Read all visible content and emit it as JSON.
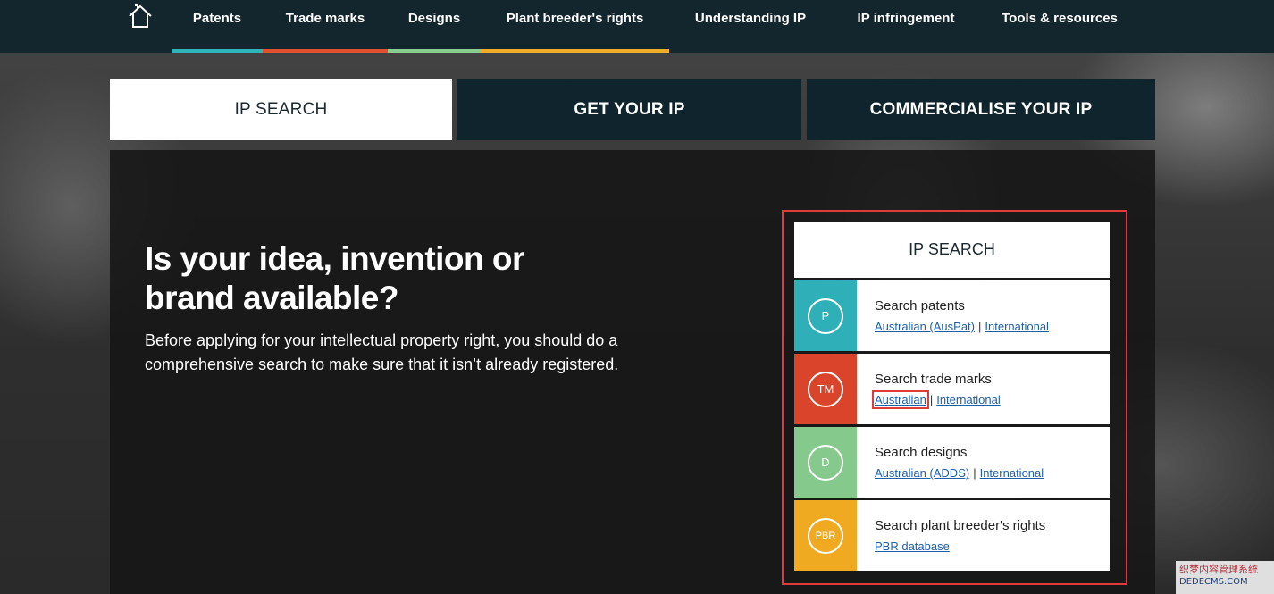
{
  "nav": {
    "items": [
      {
        "label": "Patents",
        "color": "#2fb5b9"
      },
      {
        "label": "Trade marks",
        "color": "#e0502f"
      },
      {
        "label": "Designs",
        "color": "#88cc8f"
      },
      {
        "label": "Plant breeder's rights",
        "color": "#f0ae2a"
      },
      {
        "label": "Understanding IP",
        "color": ""
      },
      {
        "label": "IP infringement",
        "color": ""
      },
      {
        "label": "Tools & resources",
        "color": ""
      }
    ]
  },
  "tabs": [
    {
      "label": "IP SEARCH",
      "active": true
    },
    {
      "label": "GET YOUR IP",
      "active": false
    },
    {
      "label": "COMMERCIALISE YOUR IP",
      "active": false
    }
  ],
  "hero": {
    "headline_line1": "Is your idea, invention or",
    "headline_line2": "brand available?",
    "description": "Before applying for your intellectual property right, you should do a comprehensive search to make sure that it isn’t already registered."
  },
  "ip_search": {
    "title": "IP SEARCH",
    "rows": [
      {
        "badge": "P",
        "color": "#2fb0b8",
        "title": "Search patents",
        "link1": "Australian (AusPat)",
        "separator": "|",
        "link2": "International"
      },
      {
        "badge": "TM",
        "color": "#d9442a",
        "title": "Search trade marks",
        "link1": "Australian",
        "separator": "|",
        "link2": "International"
      },
      {
        "badge": "D",
        "color": "#85c98c",
        "title": "Search designs",
        "link1": "Australian (ADDS)",
        "separator": "|",
        "link2": "International"
      },
      {
        "badge": "PBR",
        "color": "#f0aa22",
        "title": "Search plant breeder's rights",
        "link1": "PBR database",
        "separator": "",
        "link2": ""
      }
    ]
  },
  "watermark": {
    "line1": "织梦内容管理系统",
    "line2": "DEDECMS.COM"
  }
}
